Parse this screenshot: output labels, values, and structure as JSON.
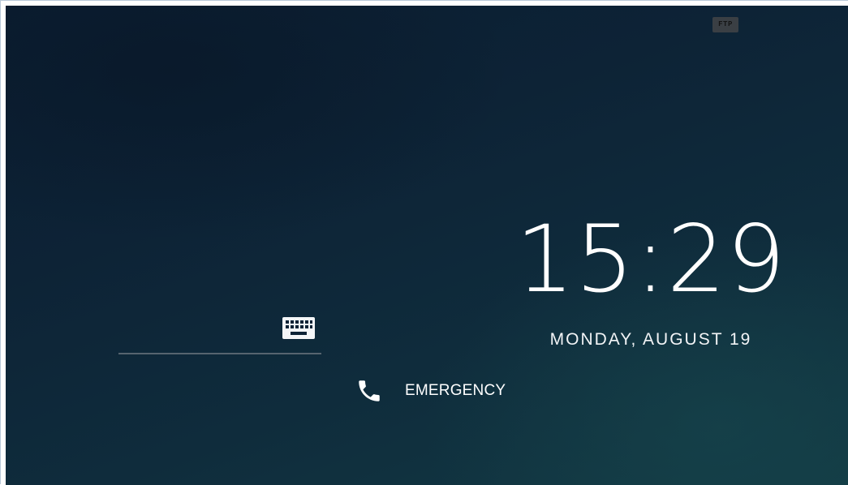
{
  "status_bar": {
    "badge_text": "FTP"
  },
  "lock_screen": {
    "time": "15:29",
    "date": "MONDAY, AUGUST 19",
    "pin_input": {
      "value": "",
      "placeholder": ""
    },
    "keyboard_icon": "keyboard-icon",
    "emergency": {
      "label": "EMERGENCY",
      "icon": "phone-icon"
    }
  },
  "colors": {
    "background_dark": "#0b1d31",
    "background_teal": "#123a44",
    "text": "#ffffff",
    "underline": "#56646f"
  }
}
